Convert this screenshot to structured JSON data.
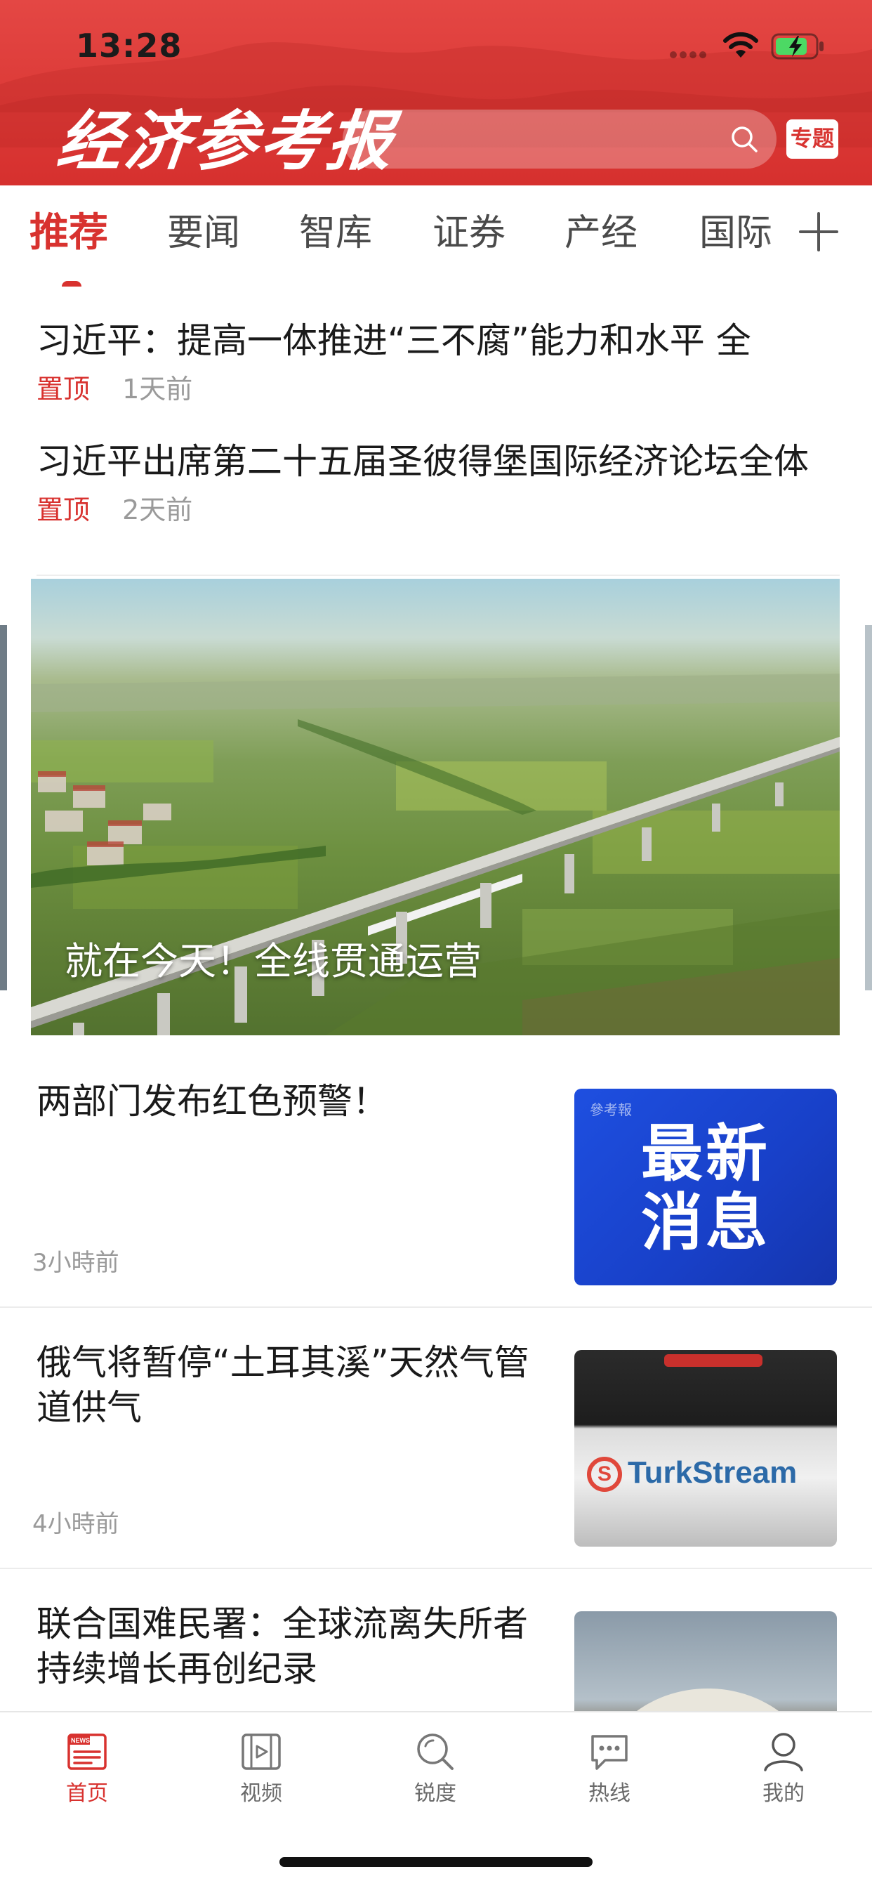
{
  "status_bar": {
    "time": "13:28"
  },
  "header": {
    "logo_text": "经济参考报",
    "search_placeholder": "",
    "topic_button_label": "专题"
  },
  "tabs": [
    {
      "label": "推荐",
      "active": true
    },
    {
      "label": "要闻",
      "active": false
    },
    {
      "label": "智库",
      "active": false
    },
    {
      "label": "证券",
      "active": false
    },
    {
      "label": "产经",
      "active": false
    },
    {
      "label": "国际",
      "active": false
    }
  ],
  "pinned": [
    {
      "title": "习近平：提高一体推进“三不腐”能力和水平 全",
      "tag": "置顶",
      "time": "1天前"
    },
    {
      "title": "习近平出席第二十五届圣彼得堡国际经济论坛全体",
      "tag": "置顶",
      "time": "2天前"
    }
  ],
  "banner": {
    "caption": "就在今天！全线贯通运营"
  },
  "articles": [
    {
      "title": "两部门发布红色预警！",
      "time": "3小時前",
      "thumb_label_small": "參考報",
      "thumb_label_big": "最新消息"
    },
    {
      "title": "俄气将暂停“土耳其溪”天然气管道供气",
      "time": "4小時前",
      "thumb_label": "TurkStream",
      "thumb_logo": "S"
    },
    {
      "title": "联合国难民署：全球流离失所者持续增长再创纪录",
      "time": ""
    }
  ],
  "bottom_nav": [
    {
      "label": "首页",
      "icon": "news-icon",
      "active": true
    },
    {
      "label": "视频",
      "icon": "video-icon",
      "active": false
    },
    {
      "label": "锐度",
      "icon": "search-icon",
      "active": false
    },
    {
      "label": "热线",
      "icon": "chat-icon",
      "active": false
    },
    {
      "label": "我的",
      "icon": "user-icon",
      "active": false
    }
  ],
  "colors": {
    "brand_red": "#d8322f",
    "header_red": "#dc3a37",
    "muted_gray": "#9a9a9a"
  }
}
